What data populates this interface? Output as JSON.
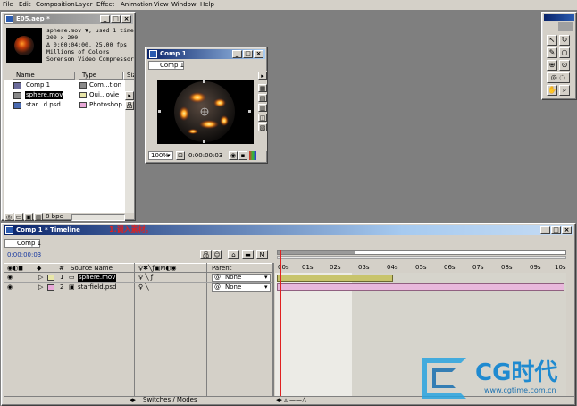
{
  "menu": [
    "File",
    "Edit",
    "Composition",
    "Layer",
    "Effect",
    "Animation",
    "View",
    "Window",
    "Help"
  ],
  "project": {
    "title": "E05.aep *",
    "info_lines": [
      "sphere.mov ▼, used 1 time",
      "200 x 200",
      "Δ 0:00:04:00, 25.00 fps",
      "Millions of Colors",
      "Sorenson Video Compressor"
    ],
    "headers": {
      "name": "Name",
      "type": "Type",
      "size": "Siz"
    },
    "items": [
      {
        "name": "Comp 1",
        "type": "Com...tion",
        "color": "#8a8a8a"
      },
      {
        "name": "sphere.mov",
        "type": "Qui...ovie",
        "color": "#e8e6a8"
      },
      {
        "name": "star...d.psd",
        "type": "Photoshop",
        "color": "#e8a8d8"
      }
    ],
    "bpc": "8 bpc"
  },
  "comp_window": {
    "title": "Comp 1",
    "tab": "Comp 1",
    "zoom": "100%",
    "timecode": "0:00:00:03"
  },
  "timeline": {
    "title": "Comp 1 * Timeline",
    "annotation": "1.调入素材。",
    "tab": "Comp 1",
    "current_time": "0:00:00:03",
    "col_headers": {
      "num": "#",
      "source": "Source Name",
      "parent": "Parent"
    },
    "layers": [
      {
        "num": "1",
        "name": "sphere.mov",
        "parent": "None"
      },
      {
        "num": "2",
        "name": "starfield.psd",
        "parent": "None"
      }
    ],
    "ruler": [
      "00s",
      "01s",
      "02s",
      "03s",
      "04s",
      "05s",
      "06s",
      "07s",
      "08s",
      "09s",
      "10s"
    ],
    "switches_label": "Switches / Modes"
  },
  "watermark": {
    "brand": "CG时代",
    "url": "www.cgtime.com.cn"
  }
}
